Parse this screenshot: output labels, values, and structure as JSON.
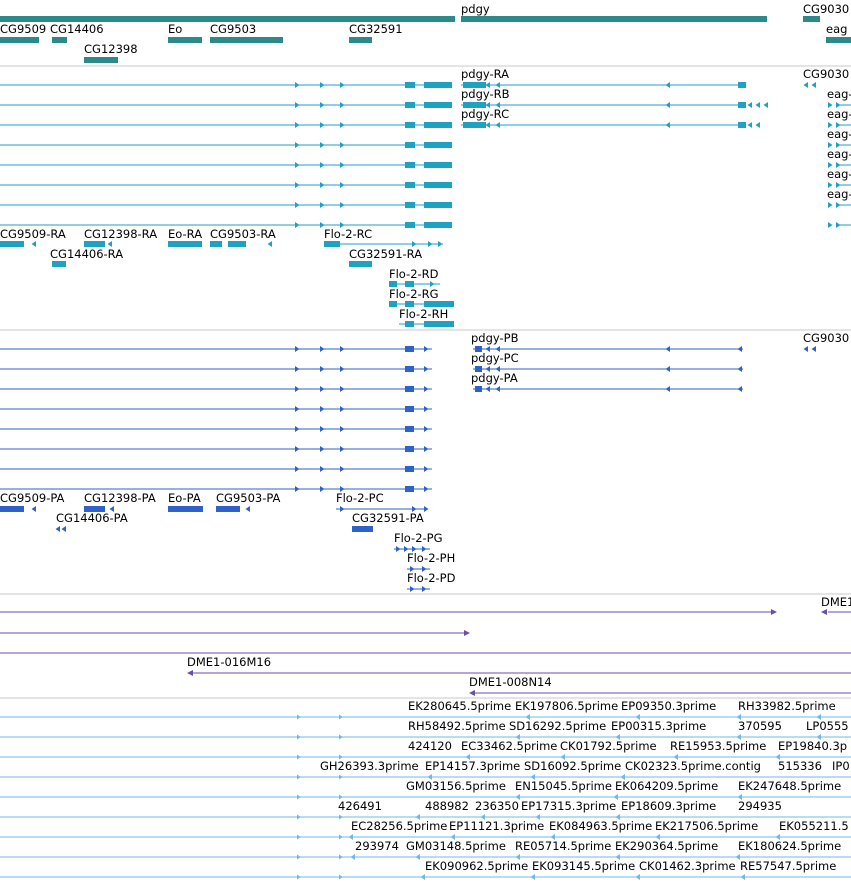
{
  "colors": {
    "gene": "#2d8a8a",
    "transcript": "#1fa2c1",
    "protein": "#2f62c9",
    "clone": "#6b4fa8",
    "est": "#72b8e0",
    "divider": "#c8c8c8"
  },
  "gene_track": {
    "labels": [
      "pdgy",
      "CG9030",
      "CG9509",
      "CG14406",
      "Eo",
      "CG9503",
      "CG32591",
      "eag",
      "CG12398"
    ]
  },
  "transcript_track": {
    "labels": [
      "pdgy-RA",
      "CG9030",
      "pdgy-RB",
      "eag-",
      "pdgy-RC",
      "eag-",
      "eag-",
      "eag-",
      "eag-",
      "eag-",
      "CG9509-RA",
      "CG12398-RA",
      "Eo-RA",
      "CG9503-RA",
      "Flo-2-RC",
      "CG14406-RA",
      "CG32591-RA",
      "Flo-2-RD",
      "Flo-2-RG",
      "Flo-2-RH"
    ]
  },
  "protein_track": {
    "labels": [
      "pdgy-PB",
      "CG9030",
      "pdgy-PC",
      "pdgy-PA",
      "CG9509-PA",
      "CG12398-PA",
      "Eo-PA",
      "CG9503-PA",
      "Flo-2-PC",
      "CG14406-PA",
      "CG32591-PA",
      "Flo-2-PG",
      "Flo-2-PH",
      "Flo-2-PD"
    ]
  },
  "clone_track": {
    "labels": [
      "DME1",
      "DME1-016M16",
      "DME1-008N14"
    ]
  },
  "est_track": {
    "labels": [
      "EK280645.5prime",
      "EK197806.5prime",
      "EP09350.3prime",
      "RH33982.5prime",
      "RH58492.5prime",
      "SD16292.5prime",
      "EP00315.3prime",
      "370595",
      "LP0555",
      "424120",
      "EC33462.5prime",
      "CK01792.5prime",
      "RE15953.5prime",
      "EP19840.3p",
      "GH26393.3prime",
      "EP14157.3prime",
      "SD16092.5prime",
      "CK02323.5prime.contig",
      "515336",
      "IP0",
      "GM03156.5prime",
      "EN15045.5prime",
      "EK064209.5prime",
      "EK247648.5prime",
      "426491",
      "488982",
      "236350",
      "EP17315.3prime",
      "EP18609.3prime",
      "294935",
      "EC28256.5prime",
      "EP11121.3prime",
      "EK084963.5prime",
      "EK217506.5prime",
      "EK055211.5",
      "293974",
      "GM03148.5prime",
      "RE05714.5prime",
      "EK290364.5prime",
      "EK180624.5prime",
      "EK090962.5prime",
      "EK093145.5prime",
      "CK01462.3prime",
      "RE57547.5prime"
    ]
  }
}
